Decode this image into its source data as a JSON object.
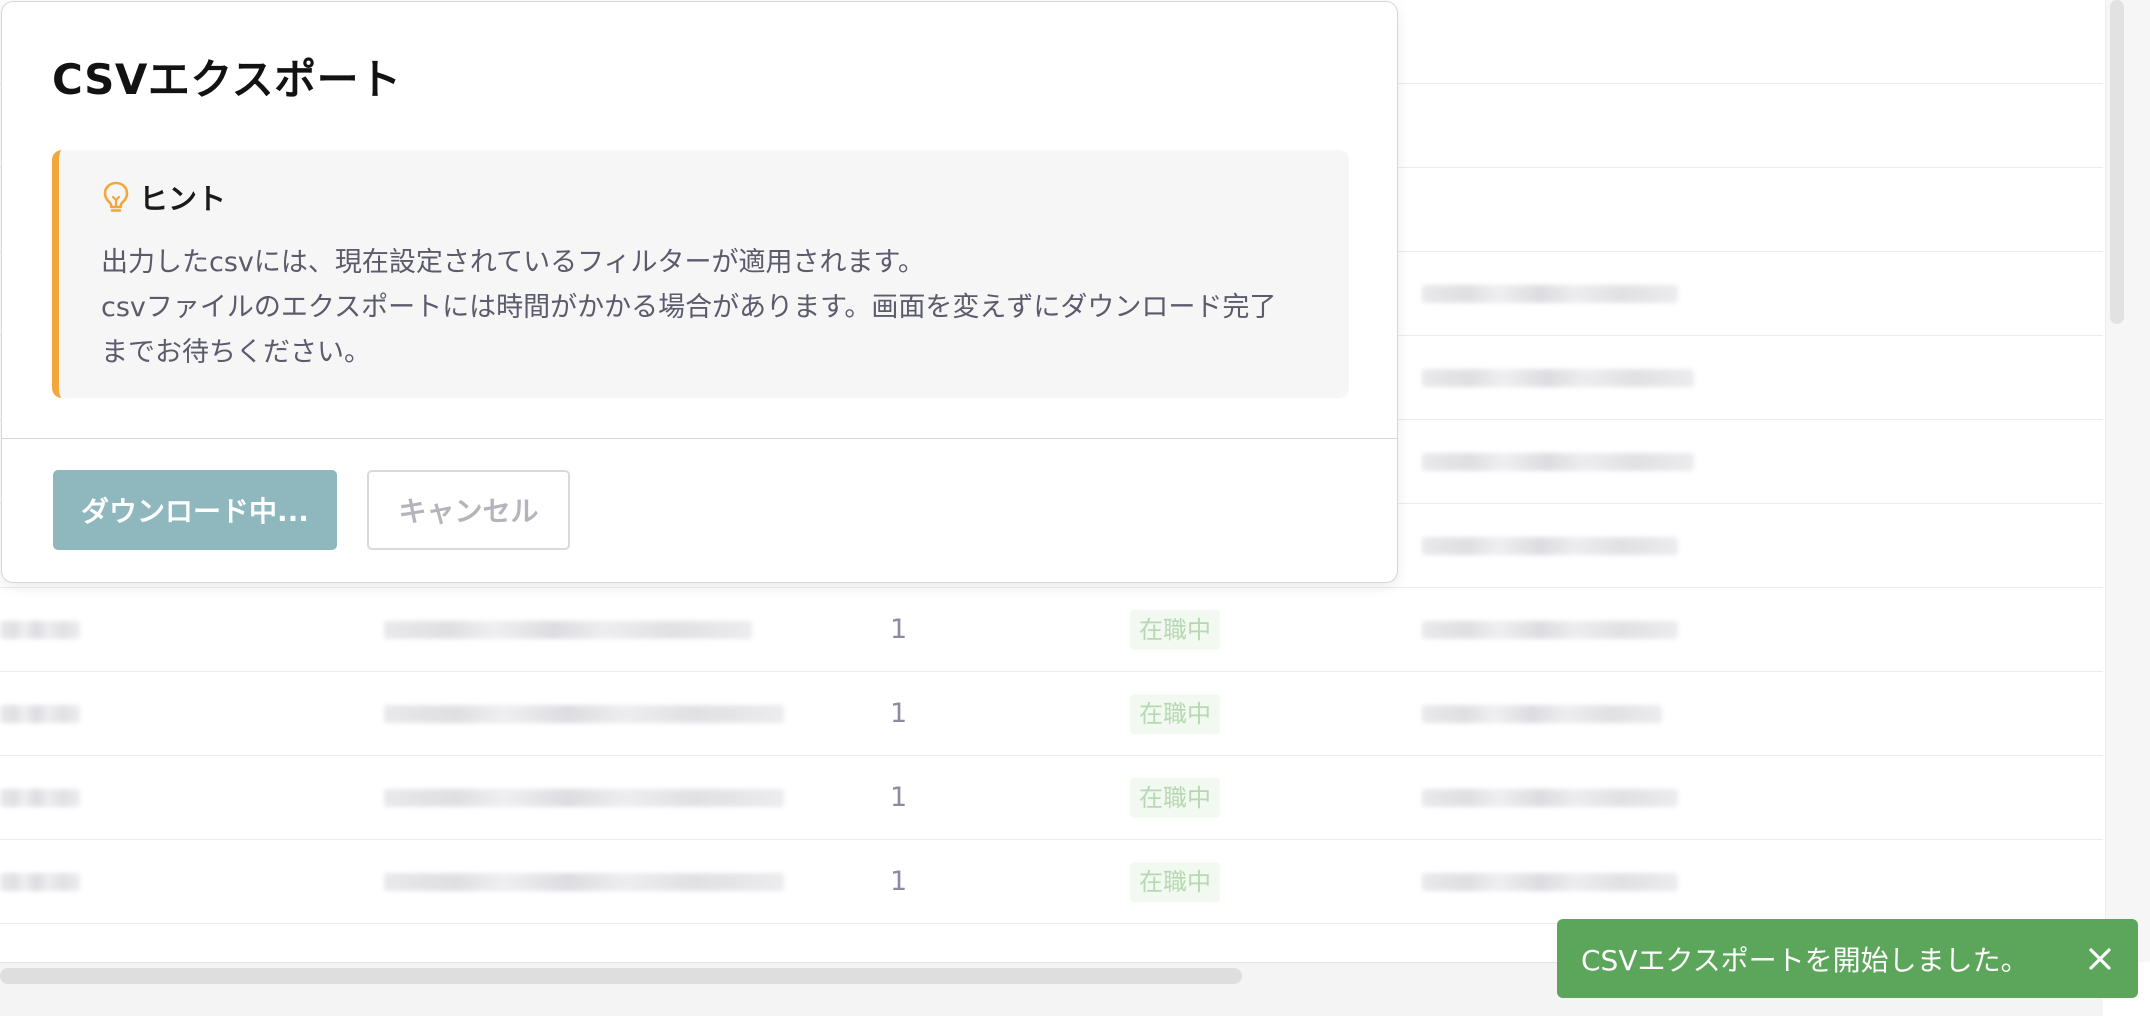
{
  "modal": {
    "title": "CSVエクスポート",
    "hint": {
      "title": "ヒント",
      "icon": "lightbulb-icon",
      "lines": [
        "出力したcsvには、現在設定されているフィルターが適用されます。",
        "csvファイルのエクスポートには時間がかかる場合があります。画面を変えずにダウンロード完了",
        "までお待ちください。"
      ]
    },
    "primary_button": "ダウンロード中...",
    "cancel_button": "キャンセル"
  },
  "table": {
    "rows": [
      {
        "count": "1",
        "status": "在職中"
      },
      {
        "count": "1",
        "status": "在職中"
      },
      {
        "count": "1",
        "status": "在職中"
      },
      {
        "count": "1",
        "status": "在職中"
      }
    ]
  },
  "toast": {
    "message": "CSVエクスポートを開始しました。",
    "close_icon": "close-icon"
  },
  "colors": {
    "hint_accent": "#f3a63a",
    "primary_button": "#8fb7be",
    "toast_background": "#5ba65a",
    "status_text": "#b6d8b3",
    "status_background": "#f2f9f0"
  }
}
